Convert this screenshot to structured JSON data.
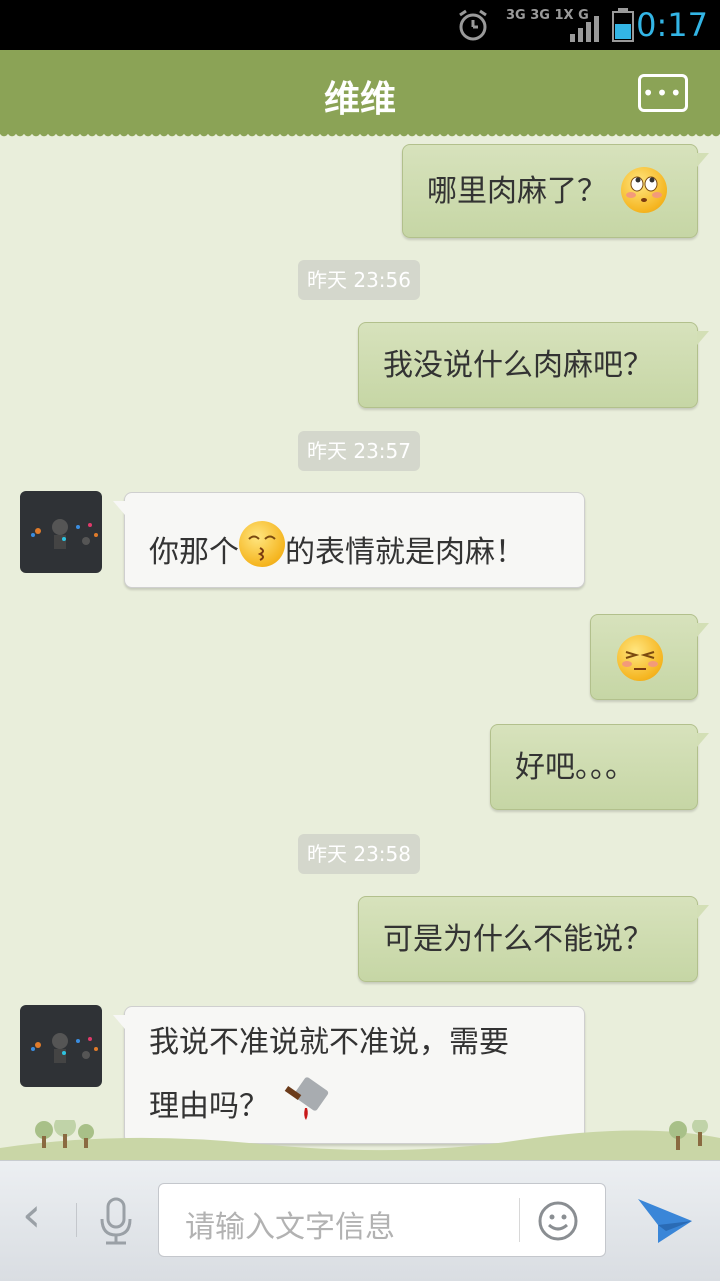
{
  "status_bar": {
    "time": "0:17",
    "network": "3G 3G 1X G"
  },
  "header": {
    "title": "维维",
    "more_label": "•••"
  },
  "messages": [
    {
      "side": "me",
      "text": "哪里肉麻了？",
      "emoji": "rolling-eyes-emoji"
    },
    {
      "type": "time",
      "text": "昨天 23:56"
    },
    {
      "side": "me",
      "text": "我没说什么肉麻吧？"
    },
    {
      "type": "time",
      "text": "昨天 23:57"
    },
    {
      "side": "them",
      "text_before": "你那个",
      "emoji": "kiss-emoji",
      "text_after": "的表情就是肉麻！"
    },
    {
      "side": "me",
      "emoji": "squint-emoji"
    },
    {
      "side": "me",
      "text": "好吧。。。"
    },
    {
      "type": "time",
      "text": "昨天 23:58"
    },
    {
      "side": "me",
      "text": "可是为什么不能说？"
    },
    {
      "side": "them",
      "line1": "我说不准说就不准说，需要",
      "line2": "理由吗？",
      "emoji": "cleaver-emoji"
    }
  ],
  "input_bar": {
    "placeholder": "请输入文字信息",
    "back_glyph": "‹"
  }
}
